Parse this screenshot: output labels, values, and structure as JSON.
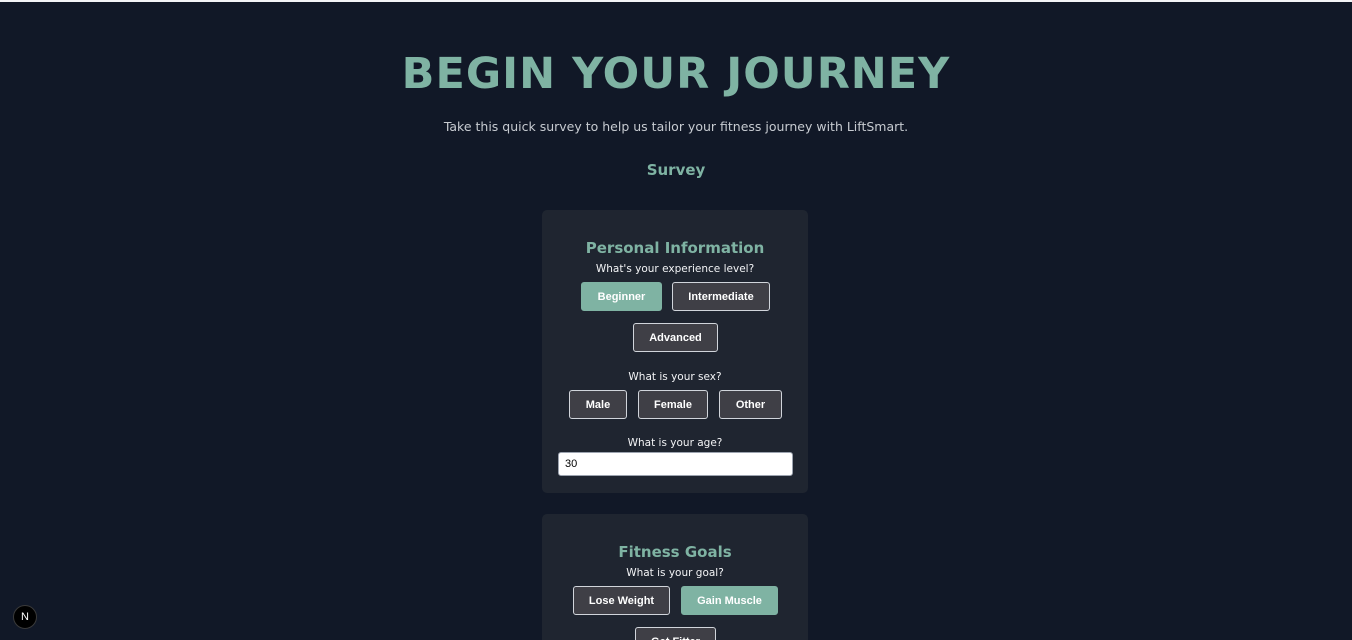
{
  "hero": {
    "title": "BEGIN YOUR JOURNEY",
    "subtitle": "Take this quick survey to help us tailor your fitness journey with LiftSmart."
  },
  "survey_heading": "Survey",
  "personal": {
    "title": "Personal Information",
    "experience_question": "What's your experience level?",
    "experience_options": [
      "Beginner",
      "Intermediate",
      "Advanced"
    ],
    "experience_selected": "Beginner",
    "sex_question": "What is your sex?",
    "sex_options": [
      "Male",
      "Female",
      "Other"
    ],
    "age_question": "What is your age?",
    "age_value": "30"
  },
  "goals": {
    "title": "Fitness Goals",
    "goal_question": "What is your goal?",
    "goal_options": [
      "Lose Weight",
      "Gain Muscle",
      "Get Fitter"
    ],
    "goal_selected": "Gain Muscle"
  },
  "badge": {
    "letter": "N",
    "icon": "nextjs-icon"
  },
  "colors": {
    "background": "#111827",
    "card": "#1f2530",
    "accent": "#7fb3a3",
    "button": "#3f3f46"
  }
}
